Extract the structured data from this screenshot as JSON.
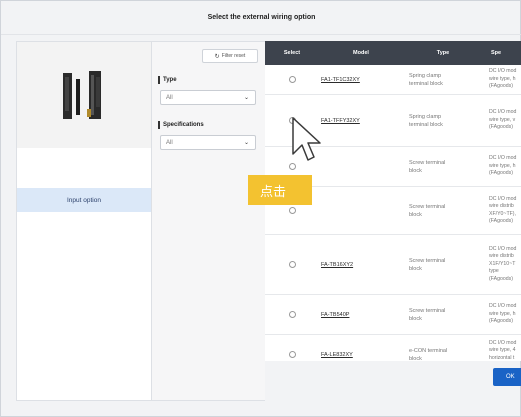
{
  "dialog": {
    "title": "Select the external wiring option"
  },
  "left_panel": {
    "image_name": "product-image",
    "option_label": "Input option"
  },
  "filters": {
    "reset_label": "Filter reset",
    "type": {
      "label": "Type",
      "value": "All"
    },
    "specifications": {
      "label": "Specifications",
      "value": "All"
    }
  },
  "table": {
    "headers": [
      "Select",
      "Model",
      "Type",
      "Spe"
    ],
    "rows": [
      {
        "model": "FA1-TF1C32XY",
        "type": "Spring clamp\nterminal block",
        "spec": "DC I/O mod\nwire type, h\n(FAgoods)"
      },
      {
        "model": "FA1-TFFY32XY",
        "type": "Spring clamp\nterminal block",
        "spec": "DC I/O mod\nwire type, v\n(FAgoods)"
      },
      {
        "model": "",
        "type": "Screw terminal\nblock",
        "spec": "DC I/O mod\nwire type, h\n(FAgoods)"
      },
      {
        "model": "",
        "type": "Screw terminal\nblock",
        "spec": "DC I/O mod\nwire distrib\nXF/Y0~TF),\n(FAgoods)"
      },
      {
        "model": "FA-TB16XY2",
        "type": "Screw terminal\nblock",
        "spec": "DC I/O mod\nwire distrib\nX1F/Y10~T\ntype\n(FAgoods)"
      },
      {
        "model": "FA-TB540P",
        "type": "Screw terminal\nblock",
        "spec": "DC I/O mod\nwire type, h\n(FAgoods)"
      },
      {
        "model": "FA-LE832XY",
        "type": "e-CON terminal\nblock",
        "spec": "DC I/O mod\nwire type, 4\nhorizontal t\n(FAgoods)"
      }
    ]
  },
  "footer": {
    "confirm_label": "OK"
  },
  "callout": {
    "text": "点击",
    "color": "#f3c230"
  },
  "colors": {
    "header_bg": "#3d434d",
    "accent": "#1a63c6",
    "selected_bg": "#dbe8f8"
  }
}
